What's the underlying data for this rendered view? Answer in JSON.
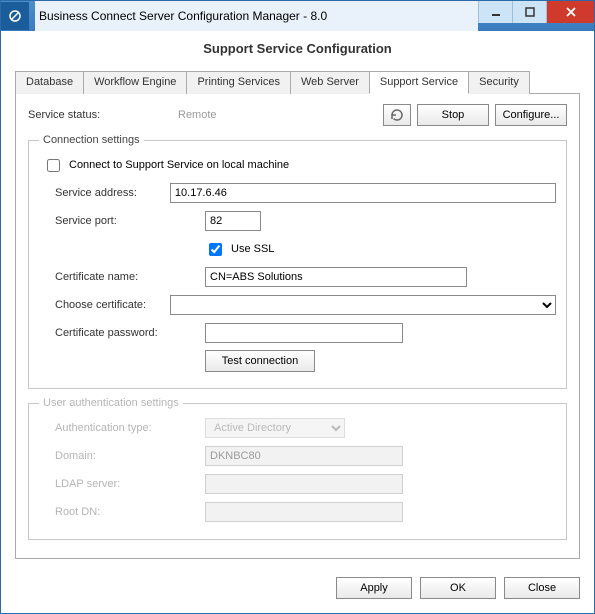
{
  "window": {
    "title": "Business Connect Server Configuration Manager - 8.0"
  },
  "page": {
    "header": "Support Service Configuration"
  },
  "tabs": {
    "items": [
      "Database",
      "Workflow Engine",
      "Printing Services",
      "Web Server",
      "Support Service",
      "Security"
    ],
    "activeIndex": 4
  },
  "status": {
    "label": "Service status:",
    "value": "Remote",
    "stop": "Stop",
    "configure": "Configure..."
  },
  "connection": {
    "legend": "Connection settings",
    "connectLocal": {
      "label": "Connect to Support Service on local machine",
      "checked": false
    },
    "serviceAddress": {
      "label": "Service address:",
      "value": "10.17.6.46"
    },
    "servicePort": {
      "label": "Service port:",
      "value": "82"
    },
    "useSSL": {
      "label": "Use SSL",
      "checked": true
    },
    "certName": {
      "label": "Certificate name:",
      "value": "CN=ABS Solutions"
    },
    "chooseCert": {
      "label": "Choose certificate:",
      "value": ""
    },
    "certPassword": {
      "label": "Certificate password:",
      "value": ""
    },
    "testConnection": "Test connection"
  },
  "auth": {
    "legend": "User authentication settings",
    "type": {
      "label": "Authentication type:",
      "value": "Active Directory"
    },
    "domain": {
      "label": "Domain:",
      "value": "DKNBC80"
    },
    "ldap": {
      "label": "LDAP server:",
      "value": ""
    },
    "rootdn": {
      "label": "Root DN:",
      "value": ""
    }
  },
  "footer": {
    "apply": "Apply",
    "ok": "OK",
    "close": "Close"
  }
}
